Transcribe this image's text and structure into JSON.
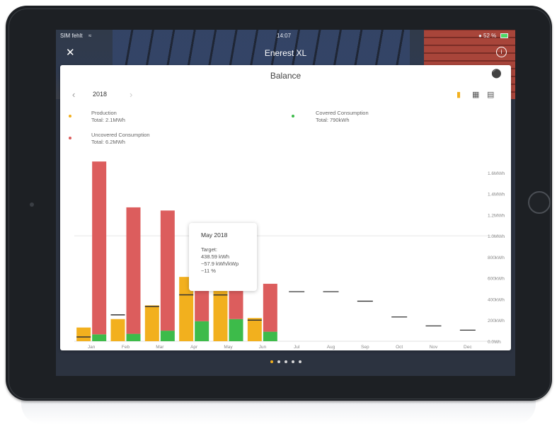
{
  "status": {
    "carrier": "SIM fehlt",
    "time": "14:07",
    "battery": "52 %"
  },
  "nav": {
    "title": "Enerest XL"
  },
  "card": {
    "title": "Balance",
    "year": "2018"
  },
  "legend": [
    {
      "label": "Production",
      "total": "Total: 2.1MWh",
      "color": "#f2b01e"
    },
    {
      "label": "Covered Consumption",
      "total": "Total: 790kWh",
      "color": "#3dbb4a"
    },
    {
      "label": "Uncovered Consumption",
      "total": "Total: 6.2MWh",
      "color": "#dc5d5d"
    }
  ],
  "tooltip": {
    "title": "May 2018",
    "line1": "Target:",
    "line2": "438.59 kWh",
    "line3": "~57.9 kWh/kWp",
    "line4": "~11 %"
  },
  "colors": {
    "production": "#f2b01e",
    "covered": "#3dbb4a",
    "uncovered": "#dc5d5d",
    "target": "#333333"
  },
  "pager": {
    "count": 5,
    "active": 0
  },
  "chart_data": {
    "type": "bar",
    "categories": [
      "Jan",
      "Feb",
      "Mar",
      "Apr",
      "May",
      "Jun",
      "Jul",
      "Aug",
      "Sep",
      "Oct",
      "Nov",
      "Dec"
    ],
    "ylim": [
      0,
      1800
    ],
    "y_ticks": [
      0,
      200,
      400,
      600,
      800,
      1000,
      1200,
      1400,
      1600
    ],
    "y_tick_labels": [
      "0.0Wh",
      "200kWh",
      "400kWh",
      "600kWh",
      "800kWh",
      "1.0MWh",
      "1.2MWh",
      "1.4MWh",
      "1.6MWh"
    ],
    "series": [
      {
        "name": "Production",
        "values": [
          130,
          210,
          340,
          610,
          530,
          220,
          null,
          null,
          null,
          null,
          null,
          null
        ]
      },
      {
        "name": "Covered Consumption",
        "values": [
          65,
          70,
          100,
          190,
          210,
          90,
          null,
          null,
          null,
          null,
          null,
          null
        ]
      },
      {
        "name": "Uncovered Consumption",
        "values": [
          1640,
          1200,
          1140,
          300,
          280,
          455,
          null,
          null,
          null,
          null,
          null,
          null
        ]
      }
    ],
    "target": [
      40,
      250,
      330,
      440,
      439,
      200,
      470,
      470,
      380,
      230,
      145,
      105
    ],
    "gridlines": [
      1000
    ]
  }
}
